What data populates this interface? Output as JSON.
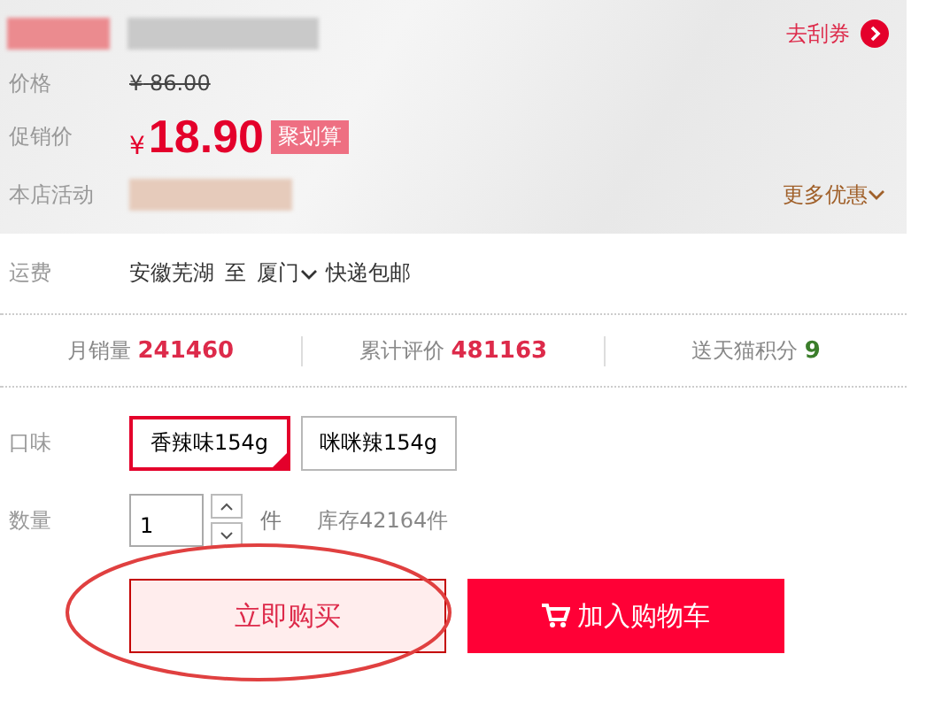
{
  "coupon_link": "去刮券",
  "price": {
    "label": "价格",
    "currency": "¥",
    "value": "86.00"
  },
  "promo_price": {
    "label": "促销价",
    "currency": "¥",
    "value": "18.90",
    "badge": "聚划算"
  },
  "store_activity": {
    "label": "本店活动",
    "more": "更多优惠"
  },
  "shipping": {
    "label": "运费",
    "from": "安徽芜湖",
    "to_word": "至",
    "to": "厦门",
    "method": "快递包邮"
  },
  "stats": [
    {
      "label": "月销量",
      "value": "241460",
      "color": "#dd2a4a"
    },
    {
      "label": "累计评价",
      "value": "481163",
      "color": "#dd2a4a"
    },
    {
      "label": "送天猫积分",
      "value": "9",
      "color": "#3a7d2a"
    }
  ],
  "flavor": {
    "label": "口味",
    "options": [
      {
        "label": "香辣味154g",
        "selected": true
      },
      {
        "label": "咪咪辣154g",
        "selected": false
      }
    ]
  },
  "quantity": {
    "label": "数量",
    "value": "1",
    "unit": "件",
    "stock": "库存42164件"
  },
  "buttons": [
    {
      "kind": "buy",
      "label": "立即购买"
    },
    {
      "kind": "cart",
      "label": "加入购物车"
    }
  ],
  "annotation": {
    "kind": "ellipse"
  }
}
